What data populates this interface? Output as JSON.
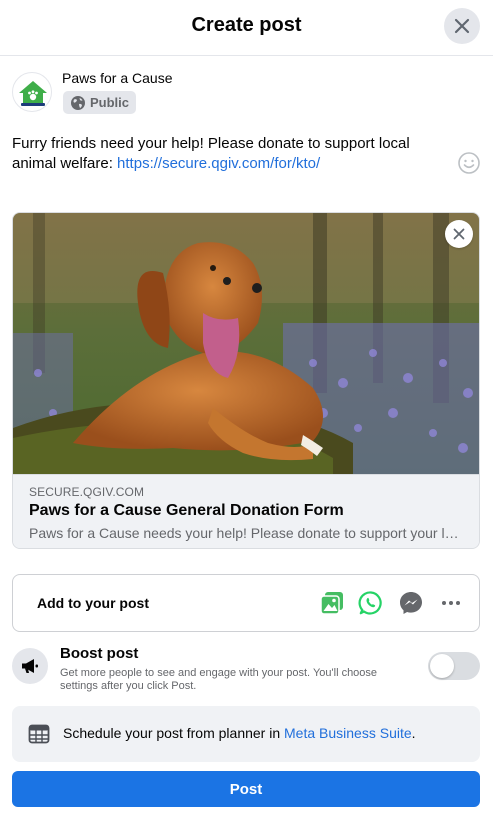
{
  "header": {
    "title": "Create post",
    "close_icon": "close-icon"
  },
  "author": {
    "name": "Paws for a Cause",
    "avatar_icon": "paws-logo-icon",
    "privacy_label": "Public",
    "privacy_icon": "globe-icon"
  },
  "post": {
    "text": "Furry friends need your help! Please donate to support local animal welfare: ",
    "link": "https://secure.qgiv.com/for/kto/",
    "emoji_icon": "smiley-icon"
  },
  "attachment": {
    "image_icon": "dog-photo",
    "remove_icon": "close-icon",
    "domain": "SECURE.QGIV.COM",
    "title": "Paws for a Cause General Donation Form",
    "description": "Paws for a Cause needs your help! Please donate to support your local animal welfare organization."
  },
  "add_to_post": {
    "label": "Add to your post",
    "icons": [
      "photo-video-icon",
      "whatsapp-icon",
      "messenger-icon",
      "more-icon"
    ]
  },
  "boost": {
    "title": "Boost post",
    "description": "Get more people to see and engage with your post. You'll choose settings after you click Post.",
    "enabled": false
  },
  "schedule": {
    "text_before": "Schedule your post from planner in ",
    "link_text": "Meta Business Suite",
    "text_after": "."
  },
  "post_button": {
    "label": "Post"
  },
  "colors": {
    "brand_blue": "#1b74e4",
    "link_blue": "#216fdb",
    "whatsapp_green": "#25d366",
    "photo_green": "#45bd62",
    "grey_bg": "#f0f2f5"
  }
}
